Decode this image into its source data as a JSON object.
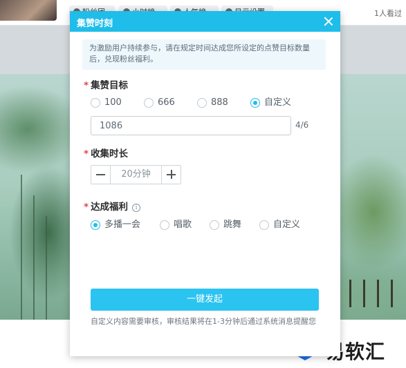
{
  "topbar": {
    "tabs": [
      {
        "label": "粉丝团"
      },
      {
        "label": "小时榜"
      },
      {
        "label": "人气榜"
      },
      {
        "label": "显示设置"
      }
    ],
    "viewers": "1人看过"
  },
  "dialog": {
    "title": "集赞时刻",
    "notice": "为激励用户持续参与，请在规定时间达成您所设定的点赞目标数量后，兑现粉丝福利。",
    "target": {
      "title": "集赞目标",
      "required_mark": "*",
      "options": [
        {
          "label": "100",
          "checked": false
        },
        {
          "label": "666",
          "checked": false
        },
        {
          "label": "888",
          "checked": false
        },
        {
          "label": "自定义",
          "checked": true
        }
      ],
      "input_value": "1086",
      "counter": "4/6"
    },
    "duration": {
      "title": "收集时长",
      "required_mark": "*",
      "value": "20分钟"
    },
    "reward": {
      "title": "达成福利",
      "required_mark": "*",
      "info_icon": "info-icon",
      "options": [
        {
          "label": "多播一会",
          "checked": true
        },
        {
          "label": "唱歌",
          "checked": false
        },
        {
          "label": "跳舞",
          "checked": false
        },
        {
          "label": "自定义",
          "checked": false
        }
      ]
    },
    "launch_label": "一键发起",
    "footnote": "自定义内容需要审核，审核结果将在1-3分钟后通过系统消息提醒您"
  },
  "watermark": {
    "text": "易软汇",
    "logo_icon": "e-logo-icon",
    "color": "#1c1c1c",
    "logo_color": "#1e6fe0"
  },
  "colors": {
    "accent": "#1fbde9",
    "button": "#2bc3f0",
    "required": "#e04848"
  }
}
